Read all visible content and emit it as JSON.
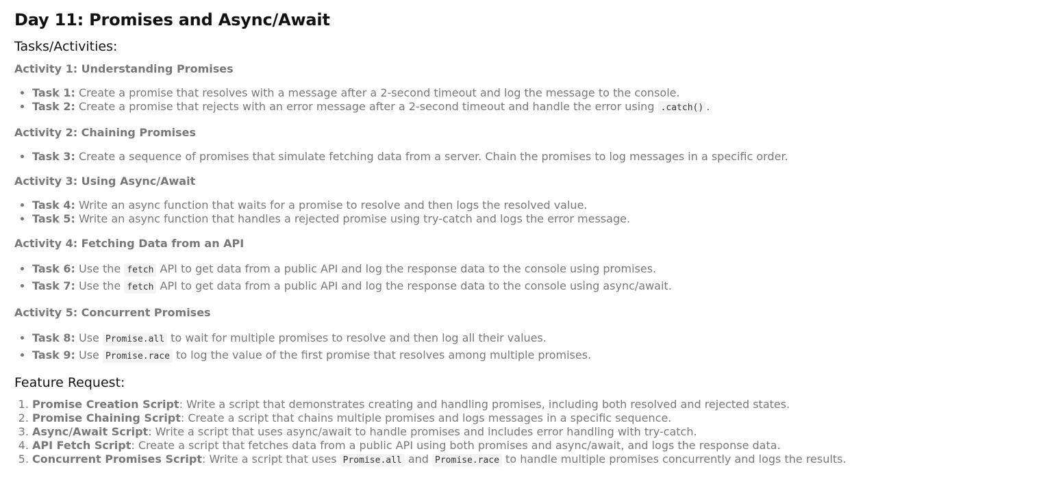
{
  "title": "Day 11: Promises and Async/Await",
  "tasks_heading": "Tasks/Activities:",
  "activities": [
    {
      "heading": "Activity 1: Understanding Promises",
      "tasks": [
        {
          "label": "Task 1:",
          "text": " Create a promise that resolves with a message after a 2-second timeout and log the message to the console."
        },
        {
          "label": "Task 2:",
          "text": " Create a promise that rejects with an error message after a 2-second timeout and handle the error using ",
          "code": ".catch()",
          "after": "."
        }
      ]
    },
    {
      "heading": "Activity 2: Chaining Promises",
      "tasks": [
        {
          "label": "Task 3:",
          "text": " Create a sequence of promises that simulate fetching data from a server. Chain the promises to log messages in a specific order."
        }
      ]
    },
    {
      "heading": "Activity 3: Using Async/Await",
      "tasks": [
        {
          "label": "Task 4:",
          "text": " Write an async function that waits for a promise to resolve and then logs the resolved value."
        },
        {
          "label": "Task 5:",
          "text": " Write an async function that handles a rejected promise using try-catch and logs the error message."
        }
      ]
    },
    {
      "heading": "Activity 4: Fetching Data from an API",
      "tasks": [
        {
          "label": "Task 6:",
          "before": " Use the ",
          "code": "fetch",
          "after": " API to get data from a public API and log the response data to the console using promises."
        },
        {
          "label": "Task 7:",
          "before": " Use the ",
          "code": "fetch",
          "after": " API to get data from a public API and log the response data to the console using async/await."
        }
      ]
    },
    {
      "heading": "Activity 5: Concurrent Promises",
      "tasks": [
        {
          "label": "Task 8:",
          "before": " Use ",
          "code": "Promise.all",
          "after": " to wait for multiple promises to resolve and then log all their values."
        },
        {
          "label": "Task 9:",
          "before": " Use ",
          "code": "Promise.race",
          "after": " to log the value of the first promise that resolves among multiple promises."
        }
      ]
    }
  ],
  "feature_heading": "Feature Request:",
  "features": [
    {
      "label": "Promise Creation Script",
      "text": ": Write a script that demonstrates creating and handling promises, including both resolved and rejected states."
    },
    {
      "label": "Promise Chaining Script",
      "text": ": Create a script that chains multiple promises and logs messages in a specific sequence."
    },
    {
      "label": "Async/Await Script",
      "text": ": Write a script that uses async/await to handle promises and includes error handling with try-catch."
    },
    {
      "label": "API Fetch Script",
      "text": ": Create a script that fetches data from a public API using both promises and async/await, and logs the response data."
    },
    {
      "label": "Concurrent Promises Script",
      "text": ": Write a script that uses ",
      "code1": "Promise.all",
      "mid": " and ",
      "code2": "Promise.race",
      "after": " to handle multiple promises concurrently and logs the results."
    }
  ]
}
